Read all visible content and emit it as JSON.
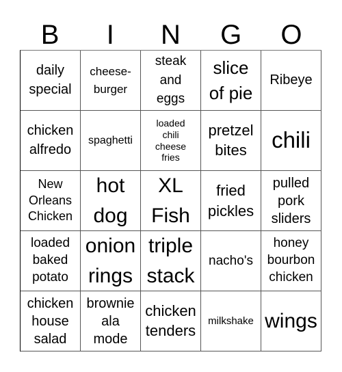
{
  "card": {
    "header": [
      "B",
      "I",
      "N",
      "G",
      "O"
    ],
    "rows": [
      [
        "daily\nspecial",
        "cheese-\nburger",
        "steak\nand\neggs",
        "slice\nof pie",
        "Ribeye"
      ],
      [
        "chicken\nalfredo",
        "spaghetti",
        "loaded\nchili\ncheese\nfries",
        "pretzel\nbites",
        "chili"
      ],
      [
        "New\nOrleans\nChicken",
        "hot\ndog",
        "XL\nFish",
        "fried\npickles",
        "pulled\npork\nsliders"
      ],
      [
        "loaded\nbaked\npotato",
        "onion\nrings",
        "triple\nstack",
        "nacho's",
        "honey\nbourbon\nchicken"
      ],
      [
        "chicken\nhouse\nsalad",
        "brownie\nala\nmode",
        "chicken\ntenders",
        "milkshake",
        "wings"
      ]
    ]
  }
}
